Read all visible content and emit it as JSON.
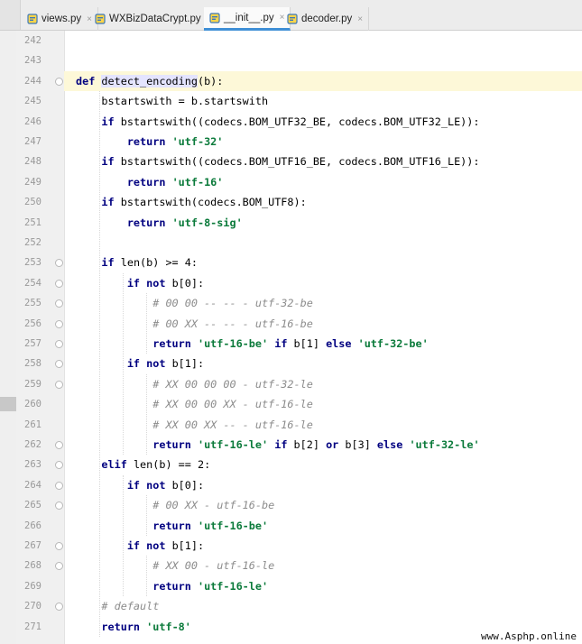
{
  "tabs": [
    {
      "label": "views.py",
      "active": false
    },
    {
      "label": "WXBizDataCrypt.py",
      "active": false
    },
    {
      "label": "__init__.py",
      "active": true
    },
    {
      "label": "decoder.py",
      "active": false
    }
  ],
  "tab_close_glyph": "×",
  "colors": {
    "keyword": "#000080",
    "string": "#0a7a3a",
    "comment": "#8c8c8c",
    "active_tab_underline": "#3f8fd6",
    "current_line": "#fdf8d8"
  },
  "lines": [
    {
      "num": "242",
      "text": ""
    },
    {
      "num": "243",
      "text": ""
    },
    {
      "num": "244",
      "text": "def detect_encoding(b):"
    },
    {
      "num": "245",
      "text": "    bstartswith = b.startswith"
    },
    {
      "num": "246",
      "text": "    if bstartswith((codecs.BOM_UTF32_BE, codecs.BOM_UTF32_LE)):"
    },
    {
      "num": "247",
      "text": "        return 'utf-32'"
    },
    {
      "num": "248",
      "text": "    if bstartswith((codecs.BOM_UTF16_BE, codecs.BOM_UTF16_LE)):"
    },
    {
      "num": "249",
      "text": "        return 'utf-16'"
    },
    {
      "num": "250",
      "text": "    if bstartswith(codecs.BOM_UTF8):"
    },
    {
      "num": "251",
      "text": "        return 'utf-8-sig'"
    },
    {
      "num": "252",
      "text": ""
    },
    {
      "num": "253",
      "text": "    if len(b) >= 4:"
    },
    {
      "num": "254",
      "text": "        if not b[0]:"
    },
    {
      "num": "255",
      "text": "            # 00 00 -- -- - utf-32-be"
    },
    {
      "num": "256",
      "text": "            # 00 XX -- -- - utf-16-be"
    },
    {
      "num": "257",
      "text": "            return 'utf-16-be' if b[1] else 'utf-32-be'"
    },
    {
      "num": "258",
      "text": "        if not b[1]:"
    },
    {
      "num": "259",
      "text": "            # XX 00 00 00 - utf-32-le"
    },
    {
      "num": "260",
      "text": "            # XX 00 00 XX - utf-16-le"
    },
    {
      "num": "261",
      "text": "            # XX 00 XX -- - utf-16-le"
    },
    {
      "num": "262",
      "text": "            return 'utf-16-le' if b[2] or b[3] else 'utf-32-le'"
    },
    {
      "num": "263",
      "text": "    elif len(b) == 2:"
    },
    {
      "num": "264",
      "text": "        if not b[0]:"
    },
    {
      "num": "265",
      "text": "            # 00 XX - utf-16-be"
    },
    {
      "num": "266",
      "text": "            return 'utf-16-be'"
    },
    {
      "num": "267",
      "text": "        if not b[1]:"
    },
    {
      "num": "268",
      "text": "            # XX 00 - utf-16-le"
    },
    {
      "num": "269",
      "text": "            return 'utf-16-le'"
    },
    {
      "num": "270",
      "text": "    # default"
    },
    {
      "num": "271",
      "text": "    return 'utf-8'"
    }
  ],
  "watermark": "www.Asphp.online"
}
